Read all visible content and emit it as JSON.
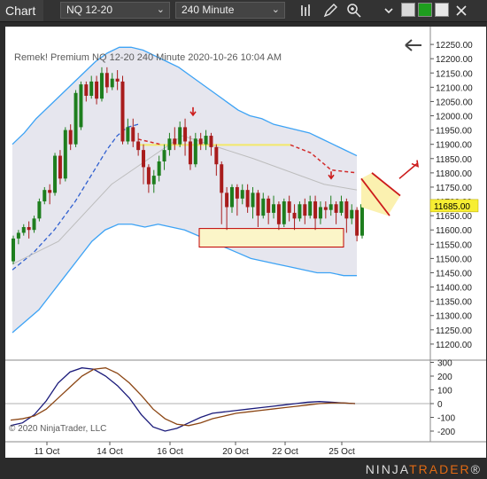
{
  "toolbar": {
    "window_title": "Chart",
    "instrument": "NQ 12-20",
    "interval": "240 Minute"
  },
  "header": {
    "info_line": "Remek!  Premium  NQ 12-20  240 Minute  2020-10-26 10:04 AM"
  },
  "copyright": "© 2020 NinjaTrader, LLC",
  "brand": {
    "part1": "NINJA",
    "part2": "TRADER",
    "mark": "®"
  },
  "colors": {
    "up_candle": "#1e7e1e",
    "down_candle": "#a81c1c",
    "band": "#3da3f5",
    "midline": "#3060d0",
    "macd": "#1a1a7a",
    "signal": "#8b4513",
    "price_marker": "#f7ee33",
    "zone_fill": "#fbf5c8",
    "zone_border": "#c00000",
    "resistance_line": "#f3e86a",
    "projection_dash": "#d22a2a"
  },
  "price_axis": {
    "ticks": [
      "12250.00",
      "12200.00",
      "12150.00",
      "12100.00",
      "12050.00",
      "12000.00",
      "11950.00",
      "11900.00",
      "11850.00",
      "11800.00",
      "11750.00",
      "11700.00",
      "11650.00",
      "11600.00",
      "11550.00",
      "11500.00",
      "11450.00",
      "11400.00",
      "11350.00",
      "11300.00",
      "11250.00",
      "11200.00"
    ],
    "current_price": "11685.00"
  },
  "indicator_axis": {
    "ticks": [
      "300",
      "200",
      "100",
      "0",
      "-100",
      "-200"
    ]
  },
  "time_axis": {
    "ticks": [
      "11 Oct",
      "14 Oct",
      "16 Oct",
      "20 Oct",
      "22 Oct",
      "25 Oct"
    ]
  },
  "chart_data": {
    "type": "candlestick",
    "ylim": [
      11150,
      12300
    ],
    "candles": [
      [
        11490,
        11570,
        11480,
        11580
      ],
      [
        11570,
        11590,
        11550,
        11600
      ],
      [
        11590,
        11610,
        11580,
        11620
      ],
      [
        11610,
        11600,
        11570,
        11630
      ],
      [
        11600,
        11640,
        11590,
        11650
      ],
      [
        11640,
        11700,
        11630,
        11710
      ],
      [
        11700,
        11740,
        11690,
        11750
      ],
      [
        11740,
        11730,
        11690,
        11760
      ],
      [
        11730,
        11860,
        11720,
        11870
      ],
      [
        11860,
        11780,
        11760,
        11880
      ],
      [
        11780,
        11950,
        11770,
        11960
      ],
      [
        11950,
        11900,
        11880,
        11970
      ],
      [
        11900,
        12080,
        11890,
        12090
      ],
      [
        11960,
        12110,
        11950,
        12120
      ],
      [
        12110,
        12070,
        12050,
        12120
      ],
      [
        12070,
        12120,
        12060,
        12140
      ],
      [
        12120,
        12060,
        12040,
        12140
      ],
      [
        12060,
        12150,
        12050,
        12170
      ],
      [
        12150,
        12100,
        12080,
        12170
      ],
      [
        12100,
        12130,
        12090,
        12150
      ],
      [
        12130,
        12120,
        12090,
        12160
      ],
      [
        12120,
        11910,
        11900,
        12140
      ],
      [
        11910,
        11960,
        11900,
        11990
      ],
      [
        11960,
        11910,
        11890,
        11990
      ],
      [
        11910,
        11880,
        11860,
        11940
      ],
      [
        11880,
        11820,
        11760,
        11900
      ],
      [
        11820,
        11760,
        11730,
        11830
      ],
      [
        11760,
        11790,
        11730,
        11810
      ],
      [
        11790,
        11840,
        11770,
        11860
      ],
      [
        11840,
        11880,
        11810,
        11900
      ],
      [
        11880,
        11920,
        11860,
        11940
      ],
      [
        11920,
        11900,
        11880,
        11960
      ],
      [
        11900,
        11960,
        11890,
        11980
      ],
      [
        11960,
        11910,
        11860,
        11990
      ],
      [
        11910,
        11830,
        11810,
        11930
      ],
      [
        11830,
        11920,
        11820,
        11940
      ],
      [
        11920,
        11900,
        11880,
        11940
      ],
      [
        11900,
        11930,
        11880,
        11950
      ],
      [
        11930,
        11890,
        11860,
        11940
      ],
      [
        11890,
        11830,
        11790,
        11900
      ],
      [
        11830,
        11730,
        11620,
        11840
      ],
      [
        11730,
        11680,
        11600,
        11750
      ],
      [
        11680,
        11750,
        11660,
        11760
      ],
      [
        11750,
        11710,
        11650,
        11760
      ],
      [
        11710,
        11740,
        11690,
        11760
      ],
      [
        11740,
        11680,
        11660,
        11760
      ],
      [
        11680,
        11730,
        11640,
        11750
      ],
      [
        11730,
        11650,
        11610,
        11740
      ],
      [
        11650,
        11710,
        11640,
        11730
      ],
      [
        11710,
        11660,
        11620,
        11720
      ],
      [
        11660,
        11690,
        11640,
        11720
      ],
      [
        11690,
        11620,
        11600,
        11700
      ],
      [
        11620,
        11700,
        11610,
        11710
      ],
      [
        11700,
        11660,
        11630,
        11720
      ],
      [
        11660,
        11640,
        11600,
        11690
      ],
      [
        11640,
        11690,
        11630,
        11700
      ],
      [
        11690,
        11650,
        11620,
        11710
      ],
      [
        11650,
        11700,
        11640,
        11720
      ],
      [
        11700,
        11640,
        11600,
        11720
      ],
      [
        11640,
        11680,
        11620,
        11700
      ],
      [
        11680,
        11670,
        11640,
        11700
      ],
      [
        11670,
        11690,
        11650,
        11720
      ],
      [
        11690,
        11660,
        11620,
        11700
      ],
      [
        11660,
        11700,
        11650,
        11720
      ],
      [
        11700,
        11640,
        11590,
        11710
      ],
      [
        11640,
        11670,
        11620,
        11690
      ],
      [
        11670,
        11580,
        11560,
        11680
      ],
      [
        11580,
        11690,
        11570,
        11700
      ]
    ],
    "upper_band": [
      11900,
      11940,
      11990,
      12030,
      12070,
      12110,
      12150,
      12190,
      12220,
      12240,
      12240,
      12230,
      12210,
      12190,
      12170,
      12140,
      12110,
      12080,
      12050,
      12020,
      12000,
      11990,
      11970,
      11960,
      11950,
      11940,
      11920,
      11900,
      11880,
      11860
    ],
    "lower_band": [
      11240,
      11280,
      11320,
      11380,
      11440,
      11500,
      11560,
      11600,
      11620,
      11620,
      11610,
      11620,
      11610,
      11600,
      11580,
      11560,
      11540,
      11520,
      11500,
      11490,
      11480,
      11470,
      11460,
      11450,
      11450,
      11440,
      11440
    ],
    "midline": [
      11460,
      11490,
      11520,
      11560,
      11600,
      11650,
      11700,
      11760,
      11820,
      11880,
      11930,
      11960,
      11970
    ],
    "macd_line": [
      -160,
      -140,
      -80,
      20,
      150,
      230,
      260,
      250,
      200,
      130,
      40,
      -80,
      -170,
      -200,
      -180,
      -140,
      -100,
      -70,
      -60,
      -50,
      -40,
      -30,
      -20,
      -10,
      0,
      10,
      15,
      10,
      5,
      0
    ],
    "signal_line": [
      -120,
      -110,
      -90,
      -40,
      40,
      120,
      200,
      250,
      260,
      220,
      150,
      60,
      -40,
      -110,
      -150,
      -160,
      -140,
      -110,
      -90,
      -70,
      -60,
      -50,
      -40,
      -30,
      -20,
      -10,
      0,
      5,
      5,
      0
    ]
  }
}
